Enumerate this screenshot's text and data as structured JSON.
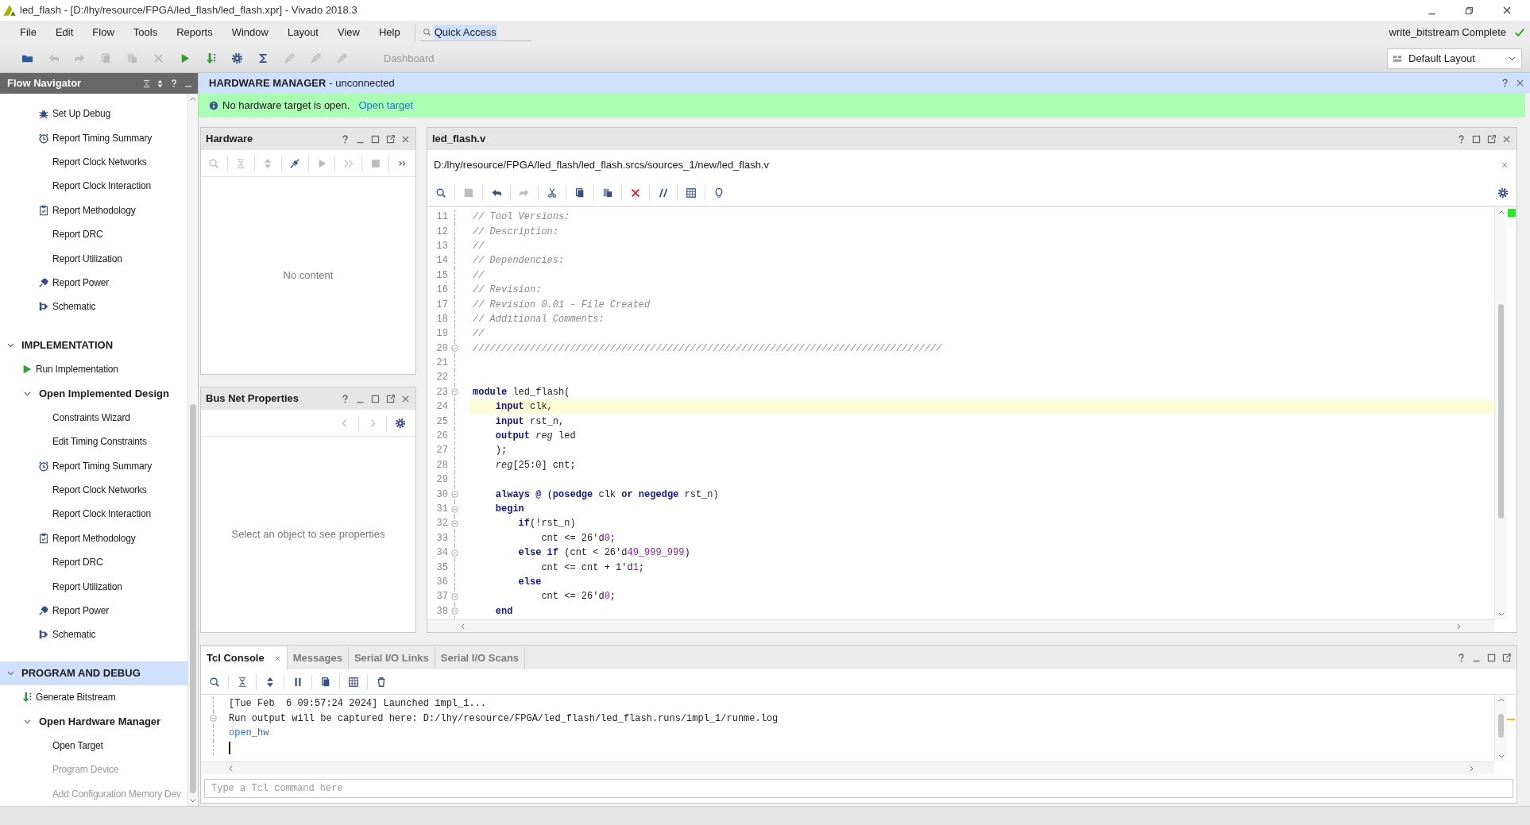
{
  "window": {
    "title": "led_flash - [D:/lhy/resource/FPGA/led_flash/led_flash.xpr] - Vivado 2018.3"
  },
  "menu": [
    "File",
    "Edit",
    "Flow",
    "Tools",
    "Reports",
    "Window",
    "Layout",
    "View",
    "Help"
  ],
  "quick_access": {
    "value": "Quick Access"
  },
  "status": {
    "text": "write_bitstream Complete"
  },
  "toolbar": {
    "dashboard": "Dashboard",
    "layout": "Default Layout"
  },
  "flow_navigator": {
    "title": "Flow Navigator",
    "sections": [
      {
        "items": [
          {
            "label": "Set Up Debug",
            "kind": "debug"
          },
          {
            "label": "Report Timing Summary",
            "kind": "timing"
          },
          {
            "label": "Report Clock Networks"
          },
          {
            "label": "Report Clock Interaction"
          },
          {
            "label": "Report Methodology",
            "kind": "methodology"
          },
          {
            "label": "Report DRC"
          },
          {
            "label": "Report Utilization"
          },
          {
            "label": "Report Power",
            "kind": "power"
          },
          {
            "label": "Schematic",
            "kind": "schematic"
          }
        ]
      },
      {
        "title": "IMPLEMENTATION",
        "expanded": true,
        "selected": false,
        "items": [
          {
            "label": "Run Implementation",
            "kind": "run"
          },
          {
            "label": "Open Implemented Design",
            "expanded": true,
            "children": [
              {
                "label": "Constraints Wizard"
              },
              {
                "label": "Edit Timing Constraints"
              },
              {
                "label": "Report Timing Summary",
                "kind": "timing"
              },
              {
                "label": "Report Clock Networks"
              },
              {
                "label": "Report Clock Interaction"
              },
              {
                "label": "Report Methodology",
                "kind": "methodology"
              },
              {
                "label": "Report DRC"
              },
              {
                "label": "Report Utilization"
              },
              {
                "label": "Report Power",
                "kind": "power"
              },
              {
                "label": "Schematic",
                "kind": "schematic"
              }
            ]
          }
        ]
      },
      {
        "title": "PROGRAM AND DEBUG",
        "expanded": true,
        "selected": true,
        "items": [
          {
            "label": "Generate Bitstream",
            "kind": "bitstream"
          },
          {
            "label": "Open Hardware Manager",
            "expanded": true,
            "children": [
              {
                "label": "Open Target",
                "disabled": false
              },
              {
                "label": "Program Device",
                "disabled": true
              },
              {
                "label": "Add Configuration Memory Dev",
                "disabled": true
              }
            ]
          }
        ]
      }
    ]
  },
  "hardware_manager": {
    "title": "HARDWARE MANAGER",
    "subtitle": "- unconnected",
    "banner": {
      "message": "No hardware target is open.",
      "link": "Open target"
    }
  },
  "hardware_panel": {
    "title": "Hardware",
    "empty": "No content"
  },
  "properties_panel": {
    "title": "Bus Net Properties",
    "empty": "Select an object to see properties"
  },
  "editor": {
    "tab": "led_flash.v",
    "path": "D:/lhy/resource/FPGA/led_flash/led_flash.srcs/sources_1/new/led_flash.v",
    "lines": [
      {
        "number": "11",
        "fold": false,
        "current": false,
        "segments": [
          {
            "text": "// Tool Versions:",
            "kind": "comment"
          }
        ]
      },
      {
        "number": "12",
        "fold": false,
        "current": false,
        "segments": [
          {
            "text": "// Description:",
            "kind": "comment"
          }
        ]
      },
      {
        "number": "13",
        "fold": false,
        "current": false,
        "segments": [
          {
            "text": "//",
            "kind": "comment"
          }
        ]
      },
      {
        "number": "14",
        "fold": false,
        "current": false,
        "segments": [
          {
            "text": "// Dependencies:",
            "kind": "comment"
          }
        ]
      },
      {
        "number": "15",
        "fold": false,
        "current": false,
        "segments": [
          {
            "text": "//",
            "kind": "comment"
          }
        ]
      },
      {
        "number": "16",
        "fold": false,
        "current": false,
        "segments": [
          {
            "text": "// Revision:",
            "kind": "comment"
          }
        ]
      },
      {
        "number": "17",
        "fold": false,
        "current": false,
        "segments": [
          {
            "text": "// Revision 0.01 - File Created",
            "kind": "comment"
          }
        ]
      },
      {
        "number": "18",
        "fold": false,
        "current": false,
        "segments": [
          {
            "text": "// Additional Comments:",
            "kind": "comment"
          }
        ]
      },
      {
        "number": "19",
        "fold": false,
        "current": false,
        "segments": [
          {
            "text": "//",
            "kind": "comment"
          }
        ]
      },
      {
        "number": "20",
        "fold": true,
        "current": false,
        "segments": [
          {
            "text": "//////////////////////////////////////////////////////////////////////////////////",
            "kind": "comment"
          }
        ]
      },
      {
        "number": "21",
        "fold": false,
        "current": false
      },
      {
        "number": "22",
        "fold": false,
        "current": false
      },
      {
        "number": "23",
        "fold": true,
        "current": false,
        "segments": [
          {
            "text": "module",
            "kind": "keyword"
          },
          {
            "text": " led_flash(",
            "kind": "plain"
          }
        ]
      },
      {
        "number": "24",
        "fold": false,
        "current": true,
        "segments": [
          {
            "text": "    input",
            "kind": "keyword"
          },
          {
            "text": " clk,",
            "kind": "plain"
          }
        ]
      },
      {
        "number": "25",
        "fold": false,
        "current": false,
        "segments": [
          {
            "text": "    input",
            "kind": "keyword"
          },
          {
            "text": " rst_n,",
            "kind": "plain"
          }
        ]
      },
      {
        "number": "26",
        "fold": false,
        "current": false,
        "segments": [
          {
            "text": "    output ",
            "kind": "keyword"
          },
          {
            "text": "reg",
            "kind": "type"
          },
          {
            "text": " led",
            "kind": "plain"
          }
        ]
      },
      {
        "number": "27",
        "fold": false,
        "current": false,
        "segments": [
          {
            "text": "    );",
            "kind": "plain"
          }
        ]
      },
      {
        "number": "28",
        "fold": false,
        "current": false,
        "segments": [
          {
            "text": "    reg",
            "kind": "type"
          },
          {
            "text": "[25:0] cnt;",
            "kind": "plain"
          }
        ]
      },
      {
        "number": "29",
        "fold": false,
        "current": false
      },
      {
        "number": "30",
        "fold": true,
        "current": false,
        "segments": [
          {
            "text": "    always @ ",
            "kind": "keyword"
          },
          {
            "text": "(",
            "kind": "plain"
          },
          {
            "text": "posedge",
            "kind": "keyword"
          },
          {
            "text": " clk ",
            "kind": "plain"
          },
          {
            "text": "or negedge",
            "kind": "keyword"
          },
          {
            "text": " rst_n)",
            "kind": "plain"
          }
        ]
      },
      {
        "number": "31",
        "fold": true,
        "current": false,
        "segments": [
          {
            "text": "    begin",
            "kind": "keyword"
          }
        ]
      },
      {
        "number": "32",
        "fold": true,
        "current": false,
        "segments": [
          {
            "text": "        if",
            "kind": "keyword"
          },
          {
            "text": "(!rst_n)",
            "kind": "plain"
          }
        ]
      },
      {
        "number": "33",
        "fold": false,
        "current": false,
        "segments": [
          {
            "text": "            cnt <= 26'd",
            "kind": "plain"
          },
          {
            "text": "0",
            "kind": "number"
          },
          {
            "text": ";",
            "kind": "plain"
          }
        ]
      },
      {
        "number": "34",
        "fold": true,
        "current": false,
        "segments": [
          {
            "text": "        else if",
            "kind": "keyword"
          },
          {
            "text": " (cnt < 26'd",
            "kind": "plain"
          },
          {
            "text": "49_999_999",
            "kind": "number"
          },
          {
            "text": ")",
            "kind": "plain"
          }
        ]
      },
      {
        "number": "35",
        "fold": false,
        "current": false,
        "segments": [
          {
            "text": "            cnt <= cnt + 1'd",
            "kind": "plain"
          },
          {
            "text": "1",
            "kind": "number"
          },
          {
            "text": ";",
            "kind": "plain"
          }
        ]
      },
      {
        "number": "36",
        "fold": false,
        "current": false,
        "segments": [
          {
            "text": "        else",
            "kind": "keyword"
          }
        ]
      },
      {
        "number": "37",
        "fold": true,
        "current": false,
        "segments": [
          {
            "text": "            cnt <= 26'd",
            "kind": "plain"
          },
          {
            "text": "0",
            "kind": "number"
          },
          {
            "text": ";",
            "kind": "plain"
          }
        ]
      },
      {
        "number": "38",
        "fold": true,
        "current": false,
        "segments": [
          {
            "text": "    end",
            "kind": "keyword"
          }
        ]
      }
    ]
  },
  "console": {
    "tabs": [
      {
        "label": "Tcl Console",
        "selected": true
      },
      {
        "label": "Messages",
        "selected": false
      },
      {
        "label": "Serial I/O Links",
        "selected": false
      },
      {
        "label": "Serial I/O Scans",
        "selected": false
      }
    ],
    "lines": [
      {
        "text": "[Tue Feb  6 09:57:24 2024] Launched impl_1...",
        "kind": "plain",
        "fold": false
      },
      {
        "text": "Run output will be captured here: D:/lhy/resource/FPGA/led_flash/led_flash.runs/impl_1/runme.log",
        "kind": "plain",
        "fold": true
      },
      {
        "text": "open_hw",
        "kind": "command",
        "fold": false
      }
    ],
    "placeholder": "Type a Tcl command here"
  }
}
